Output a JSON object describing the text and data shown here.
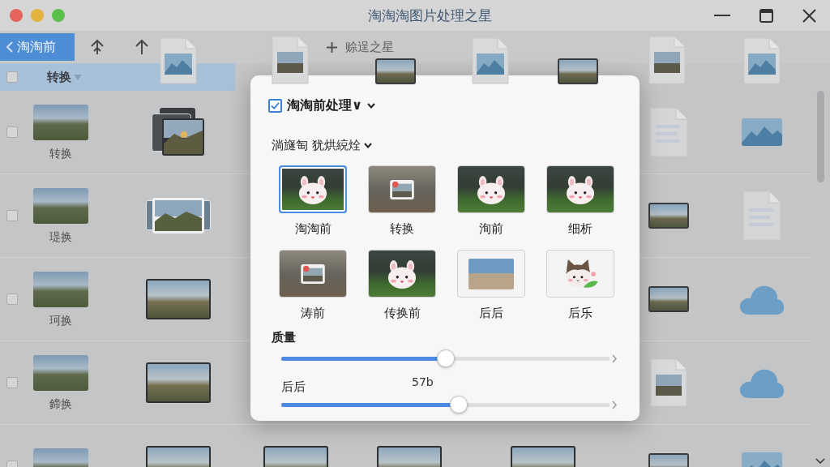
{
  "window": {
    "title": "淘淘淘图片处理之星"
  },
  "toolbar": {
    "back_button": {
      "label": "淘淘前"
    },
    "add_button": {
      "label": "赊逞之星"
    }
  },
  "top_items": [
    {
      "kind": "image-file"
    },
    {
      "kind": "photo-file"
    },
    {
      "kind": "small-photo"
    },
    {
      "kind": "image-file"
    },
    {
      "kind": "small-photo"
    },
    {
      "kind": "photo-file"
    },
    {
      "kind": "image-file"
    }
  ],
  "header_row": {
    "checked": false,
    "label": "转换"
  },
  "file_grid": {
    "rows": [
      {
        "checked": false,
        "label": "转换",
        "cells": [
          {
            "kind": "photo-stack"
          },
          {
            "kind": "document"
          },
          {
            "kind": "image"
          }
        ]
      },
      {
        "checked": false,
        "label": "瑅换",
        "cells": [
          {
            "kind": "photo-strip"
          },
          {
            "kind": "small-photo"
          },
          {
            "kind": "document"
          }
        ]
      },
      {
        "checked": false,
        "label": "珂换",
        "cells": [
          {
            "kind": "photo"
          },
          {
            "kind": "small-photo"
          },
          {
            "kind": "cloud"
          }
        ]
      },
      {
        "checked": false,
        "label": "鍗换",
        "cells": [
          {
            "kind": "photo"
          },
          {
            "kind": "photo-file"
          },
          {
            "kind": "cloud"
          }
        ]
      },
      {
        "checked": false,
        "cells": [
          {
            "kind": "photo"
          },
          {
            "kind": "photo"
          },
          {
            "kind": "photo"
          },
          {
            "kind": "photo"
          },
          {
            "kind": "small-photo"
          },
          {
            "kind": "image"
          }
        ]
      }
    ]
  },
  "dialog": {
    "header": {
      "checked": true,
      "label": "淘淘前处理∨"
    },
    "subheader": {
      "label": "淌旞匋 犹烘綂烇"
    },
    "presets": [
      {
        "label": "淘淘前",
        "kind": "bunny",
        "selected": true
      },
      {
        "label": "转换",
        "kind": "framed-photo",
        "selected": false
      },
      {
        "label": "洵前",
        "kind": "calico-bunny",
        "selected": false
      },
      {
        "label": "细析",
        "kind": "bunny",
        "selected": false
      },
      {
        "label": "涛前",
        "kind": "framed-photo",
        "selected": false
      },
      {
        "label": "传换前",
        "kind": "calico-bunny",
        "selected": false
      },
      {
        "label": "后后",
        "kind": "photo",
        "selected": false
      },
      {
        "label": "后乐",
        "kind": "sticker",
        "selected": false
      }
    ],
    "sliders": [
      {
        "label": "质量",
        "level": 0.5
      },
      {
        "label": "后后",
        "reading": "57b",
        "level": 0.54
      }
    ]
  }
}
